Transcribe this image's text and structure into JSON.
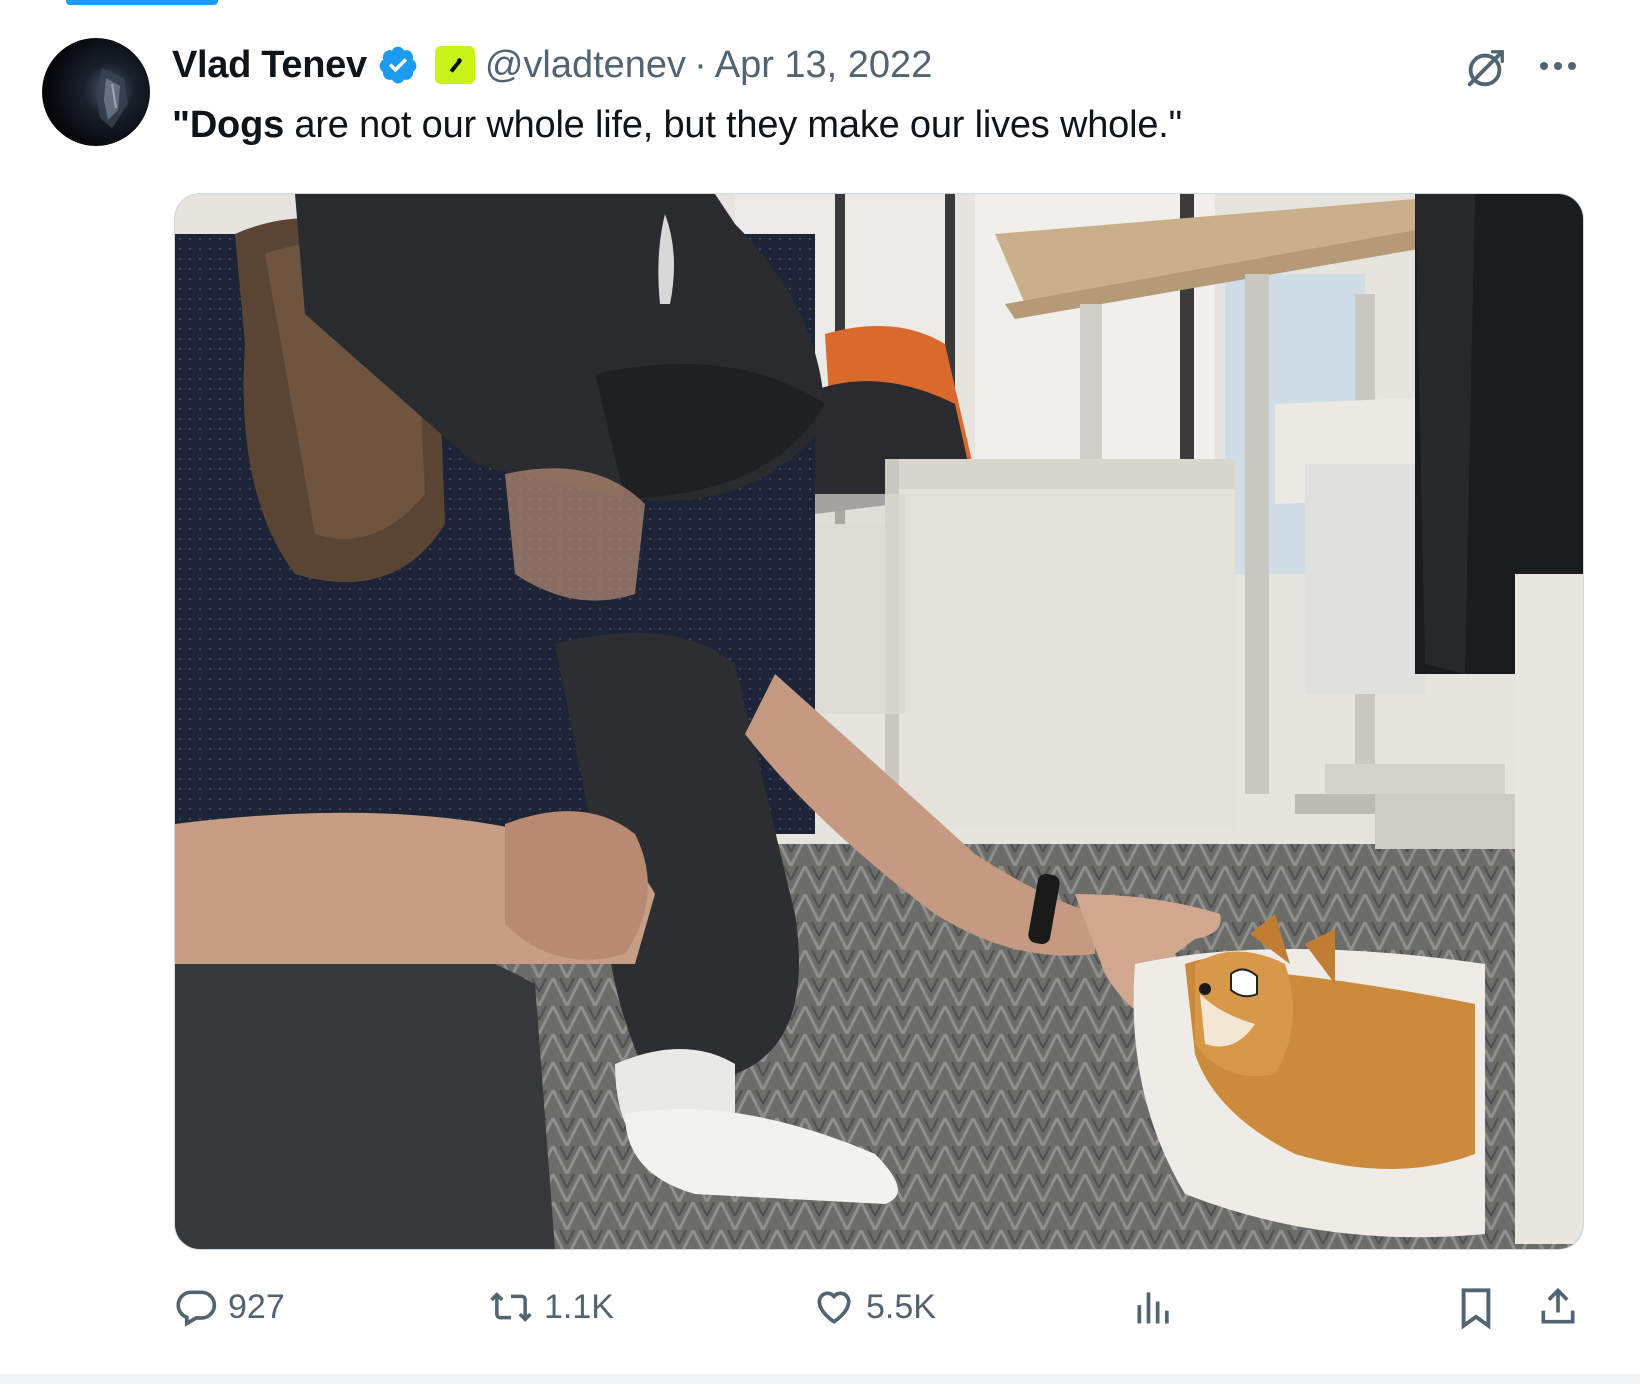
{
  "tweet": {
    "display_name": "Vlad Tenev",
    "handle": "@vladtenev",
    "separator": "·",
    "date": "Apr 13, 2022",
    "text_bold": "\"Dogs",
    "text_rest": " are not our whole life, but they make our lives whole.\"",
    "verified_icon": "verified-badge-icon",
    "affiliation_icon": "affiliate-badge-icon",
    "media_icon": "photo-image"
  },
  "metrics": {
    "replies": "927",
    "reposts": "1.1K",
    "likes": "5.5K"
  },
  "icons": {
    "reply": "reply-icon",
    "repost": "repost-icon",
    "like": "heart-icon",
    "views": "analytics-icon",
    "bookmark": "bookmark-icon",
    "share": "share-icon",
    "grok": "grok-icon",
    "more": "more-icon"
  },
  "colors": {
    "accent": "#1d9bf0",
    "affiliate": "#c9f219",
    "muted": "#536471"
  }
}
